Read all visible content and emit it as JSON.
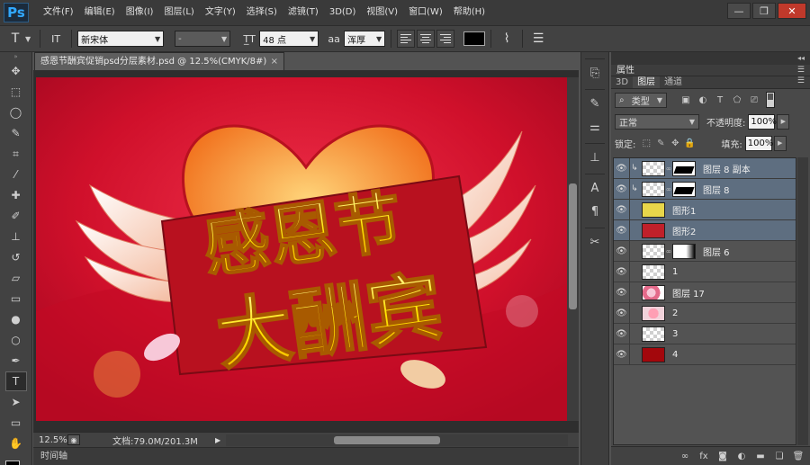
{
  "app": {
    "logo": "Ps"
  },
  "menu": [
    "文件(F)",
    "编辑(E)",
    "图像(I)",
    "图层(L)",
    "文字(Y)",
    "选择(S)",
    "滤镜(T)",
    "3D(D)",
    "视图(V)",
    "窗口(W)",
    "帮助(H)"
  ],
  "window_controls": {
    "minimize": "—",
    "restore": "❐",
    "close": "✕"
  },
  "options": {
    "tool_icon": "T",
    "orientation_icon": "IT",
    "font_family": "新宋体",
    "font_style": "-",
    "font_size": "48 点",
    "antialias": "浑厚",
    "text_color": "#000000"
  },
  "document": {
    "tab_title": "感恩节酬宾促销psd分层素材.psd @ 12.5%(CMYK/8#)",
    "tab_close": "×",
    "artwork": {
      "line1": "感恩节",
      "line2": "大酬宾"
    },
    "zoom": "12.5%",
    "doc_info": "文档:79.0M/201.3M"
  },
  "timeline": {
    "label": "时间轴"
  },
  "panels": {
    "properties_label": "属性",
    "tabs": [
      "3D",
      "图层",
      "通道"
    ],
    "active_tab": 1,
    "filter_kind": "类型",
    "blend_mode": "正常",
    "opacity_label": "不透明度:",
    "opacity_value": "100%",
    "lock_label": "锁定:",
    "fill_label": "填充:",
    "fill_value": "100%"
  },
  "layers": [
    {
      "name": "图层 8 副本",
      "thumb": "checker",
      "mask": "shape",
      "clip": true,
      "selected": true
    },
    {
      "name": "图层 8",
      "thumb": "checker",
      "mask": "shape",
      "clip": true,
      "selected": true
    },
    {
      "name": "图形1",
      "thumb": "art-yellow",
      "selected": true
    },
    {
      "name": "图形2",
      "thumb": "art-red",
      "selected": true
    },
    {
      "name": "图层 6",
      "thumb": "checker",
      "mask": "white"
    },
    {
      "name": "1",
      "thumb": "checker"
    },
    {
      "name": "图层 17",
      "thumb": "art-flower"
    },
    {
      "name": "2",
      "thumb": "art-pink"
    },
    {
      "name": "3",
      "thumb": "checker"
    },
    {
      "name": "4",
      "thumb": "fill-darkred"
    }
  ],
  "colors": {
    "canvas_bg": "#d0102b",
    "banner_red": "#b8111f",
    "title_yellow": "#ffe600",
    "selected_layer": "#5e6e80"
  }
}
